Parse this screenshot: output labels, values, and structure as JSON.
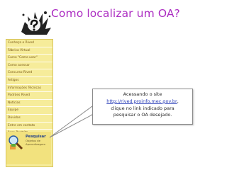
{
  "slide": {
    "title": "Como localizar um OA?"
  },
  "sidebar": {
    "items": [
      {
        "label": "Conheça o Rived"
      },
      {
        "label": "Fábrica Virtual"
      },
      {
        "label": "Curso \"Como usar\""
      },
      {
        "label": "Como acessar"
      },
      {
        "label": "Concurso Rived"
      },
      {
        "label": "Artigos"
      },
      {
        "label": "Informações Técnicas"
      },
      {
        "label": "Padrões Rived"
      },
      {
        "label": "Notícias"
      },
      {
        "label": "Equipe"
      },
      {
        "label": "Dúvidas"
      },
      {
        "label": "Entre em contato"
      },
      {
        "label": "Área Restrita"
      }
    ],
    "search": {
      "label": "Pesquisar",
      "subtitle_line1": "Objetos de",
      "subtitle_line2": "Aprendizagem"
    }
  },
  "callout": {
    "line1": "Acessando o site",
    "link": "http://rived.proinfo.mec.gov.br",
    "link_suffix": ",",
    "line3": "clique no link indicado para",
    "line4": "pesquisar o OA desejado."
  },
  "colors": {
    "title": "#ac2ec2",
    "sidebar_bg": "#f6ec9a",
    "link": "#2b3fb8"
  }
}
